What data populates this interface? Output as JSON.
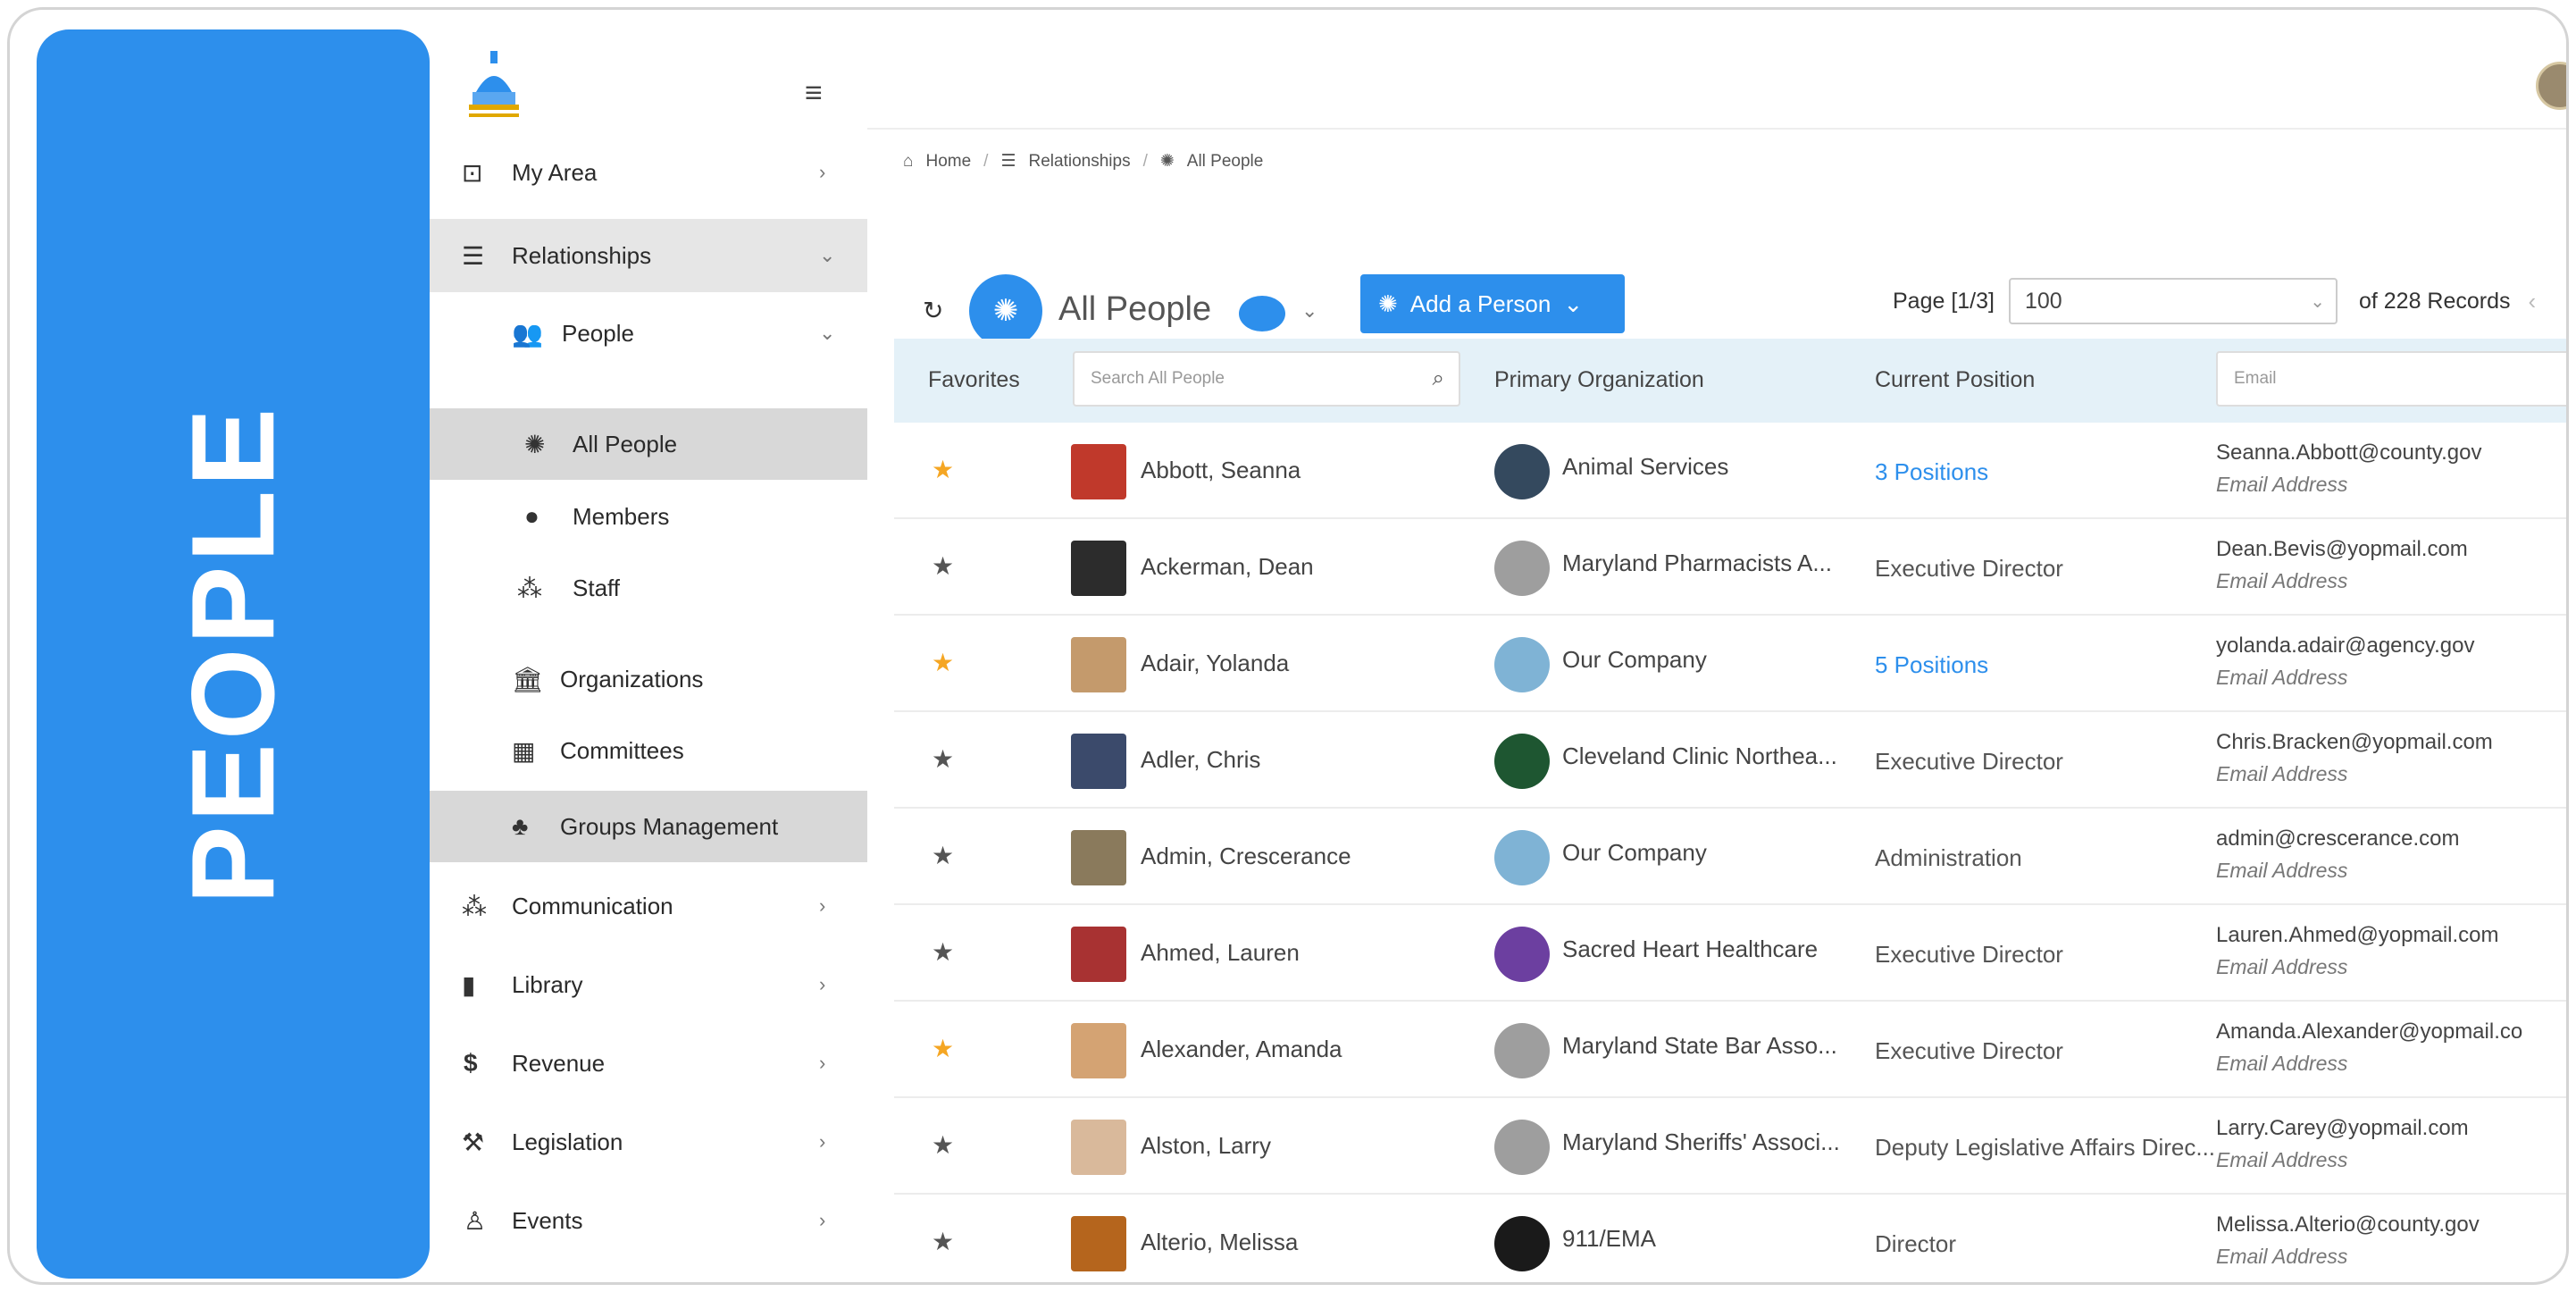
{
  "banner": {
    "text": "PEOPLE"
  },
  "sidebar": {
    "items": [
      {
        "label": "My Area",
        "icon": "target-icon",
        "chev": "›"
      },
      {
        "label": "Relationships",
        "icon": "list-icon",
        "chev": "⌄"
      },
      {
        "label": "People",
        "icon": "people-icon",
        "chev": "⌄"
      },
      {
        "label": "All People",
        "icon": "brain-icon"
      },
      {
        "label": "Members",
        "icon": "member-icon"
      },
      {
        "label": "Staff",
        "icon": "staff-icon"
      },
      {
        "label": "Organizations",
        "icon": "building-icon"
      },
      {
        "label": "Committees",
        "icon": "committee-icon"
      },
      {
        "label": "Groups Management",
        "icon": "groups-icon"
      },
      {
        "label": "Communication",
        "icon": "network-icon",
        "chev": "›"
      },
      {
        "label": "Library",
        "icon": "book-icon",
        "chev": "›"
      },
      {
        "label": "Revenue",
        "icon": "dollar-icon",
        "chev": "›"
      },
      {
        "label": "Legislation",
        "icon": "gavel-icon",
        "chev": "›"
      },
      {
        "label": "Events",
        "icon": "person-icon",
        "chev": "›"
      }
    ]
  },
  "breadcrumb": {
    "home": "Home",
    "relationships": "Relationships",
    "current": "All People"
  },
  "toolbar": {
    "title": "All People",
    "add_button": "Add a Person",
    "page_label": "Page [1/3]",
    "page_size": "100",
    "records": "of 228 Records"
  },
  "table": {
    "headers": {
      "favorites": "Favorites",
      "search_placeholder": "Search All People",
      "organization": "Primary Organization",
      "position": "Current Position",
      "email_placeholder": "Email"
    },
    "rows": [
      {
        "favorite": true,
        "name": "Abbott, Seanna",
        "org": "Animal Services",
        "position": "3 Positions",
        "position_link": true,
        "email": "Seanna.Abbott@county.gov",
        "email_label": "Email Address",
        "avatar_color": "#c0392b",
        "org_color": "#34495e"
      },
      {
        "favorite": false,
        "name": "Ackerman, Dean",
        "org": "Maryland Pharmacists A...",
        "position": "Executive Director",
        "position_link": false,
        "email": "Dean.Bevis@yopmail.com",
        "email_label": "Email Address",
        "avatar_color": "#2c2c2c",
        "org_color": "#9e9e9e"
      },
      {
        "favorite": true,
        "name": "Adair, Yolanda",
        "org": "Our Company",
        "position": "5 Positions",
        "position_link": true,
        "email": "yolanda.adair@agency.gov",
        "email_label": "Email Address",
        "avatar_color": "#c49a6c",
        "org_color": "#7fb3d5"
      },
      {
        "favorite": false,
        "name": "Adler, Chris",
        "org": "Cleveland Clinic Northea...",
        "position": "Executive Director",
        "position_link": false,
        "email": "Chris.Bracken@yopmail.com",
        "email_label": "Email Address",
        "avatar_color": "#3b4a6b",
        "org_color": "#1e5631"
      },
      {
        "favorite": false,
        "name": "Admin, Crescerance",
        "org": "Our Company",
        "position": "Administration",
        "position_link": false,
        "email": "admin@crescerance.com",
        "email_label": "Email Address",
        "avatar_color": "#8a7a5c",
        "org_color": "#7fb3d5"
      },
      {
        "favorite": false,
        "name": "Ahmed, Lauren",
        "org": "Sacred Heart Healthcare",
        "position": "Executive Director",
        "position_link": false,
        "email": "Lauren.Ahmed@yopmail.com",
        "email_label": "Email Address",
        "avatar_color": "#a83232",
        "org_color": "#6c3fa0"
      },
      {
        "favorite": true,
        "name": "Alexander, Amanda",
        "org": "Maryland State Bar Asso...",
        "position": "Executive Director",
        "position_link": false,
        "email": "Amanda.Alexander@yopmail.co",
        "email_label": "Email Address",
        "avatar_color": "#d4a373",
        "org_color": "#9e9e9e"
      },
      {
        "favorite": false,
        "name": "Alston, Larry",
        "org": "Maryland Sheriffs' Associ...",
        "position": "Deputy Legislative Affairs Direc...",
        "position_link": false,
        "email": "Larry.Carey@yopmail.com",
        "email_label": "Email Address",
        "avatar_color": "#d9b99b",
        "org_color": "#9e9e9e"
      },
      {
        "favorite": false,
        "name": "Alterio, Melissa",
        "org": "911/EMA",
        "position": "Director",
        "position_link": false,
        "email": "Melissa.Alterio@county.gov",
        "email_label": "Email Address",
        "avatar_color": "#b5651d",
        "org_color": "#1a1a1a"
      }
    ]
  },
  "colors": {
    "accent": "#2d8fec",
    "header_bg": "#e4f1f8",
    "star_on": "#f5a623"
  }
}
